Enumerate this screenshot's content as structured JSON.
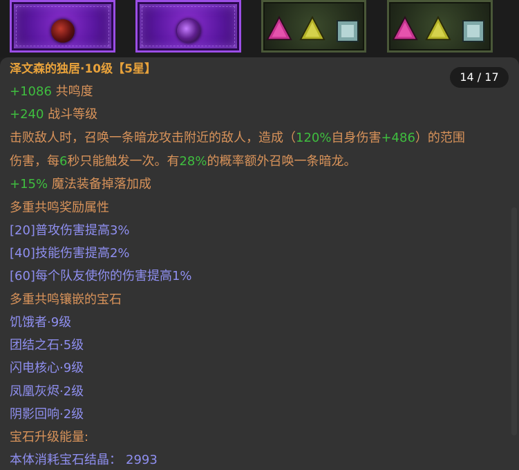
{
  "counter": "14 / 17",
  "item": {
    "name": "泽文森的独居·10级",
    "stars": "【5星】",
    "stats": [
      {
        "value": "+1086",
        "label": " 共鸣度"
      },
      {
        "value": "+240",
        "label": " 战斗等级"
      }
    ],
    "effect": {
      "line1_a": "击败敌人时，召唤一条暗龙攻击附近的敌人，造成（",
      "line1_b": "120%",
      "line1_c": "自身伤害",
      "line1_d": "+486",
      "line1_e": "）的范围",
      "line2_a": "伤害，每",
      "line2_b": "6",
      "line2_c": "秒只能触发一次。有",
      "line2_d": "28%",
      "line2_e": "的概率额外召唤一条暗龙。"
    },
    "magic_drop": {
      "value": "+15%",
      "label": " 魔法装备掉落加成"
    },
    "resonance_bonus_header": "多重共鸣奖励属性",
    "resonance_bonuses": [
      "[20]普攻伤害提高3%",
      "[40]技能伤害提高2%",
      "[60]每个队友使你的伤害提高1%"
    ],
    "socket_header": "多重共鸣镶嵌的宝石",
    "gems": [
      "饥饿者·9级",
      "团结之石·5级",
      "闪电核心·9级",
      "凤凰灰烬·2级",
      "阴影回响·2级"
    ],
    "upgrade_header": "宝石升级能量:",
    "upgrade_cost_label": "本体消耗宝石结晶：",
    "upgrade_cost_value": "2993"
  },
  "colors": {
    "title": "#e8a23b",
    "green": "#3fbe3f",
    "desc": "#d9935a",
    "blue": "#8f8ff0",
    "panel": "#333333"
  },
  "icons": {
    "slot1": "red-orb-gem-icon",
    "slot2": "violet-orb-gem-icon",
    "tri_pink": "pink-triangle-gem-icon",
    "tri_yellow": "yellow-triangle-gem-icon",
    "square_teal": "teal-square-gem-icon"
  }
}
